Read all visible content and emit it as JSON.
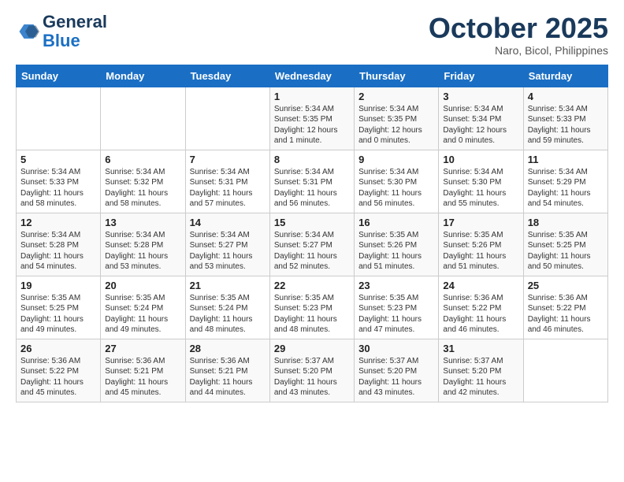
{
  "header": {
    "logo_line1": "General",
    "logo_line2": "Blue",
    "month": "October 2025",
    "location": "Naro, Bicol, Philippines"
  },
  "days_of_week": [
    "Sunday",
    "Monday",
    "Tuesday",
    "Wednesday",
    "Thursday",
    "Friday",
    "Saturday"
  ],
  "weeks": [
    [
      {
        "day": "",
        "info": ""
      },
      {
        "day": "",
        "info": ""
      },
      {
        "day": "",
        "info": ""
      },
      {
        "day": "1",
        "info": "Sunrise: 5:34 AM\nSunset: 5:35 PM\nDaylight: 12 hours\nand 1 minute."
      },
      {
        "day": "2",
        "info": "Sunrise: 5:34 AM\nSunset: 5:35 PM\nDaylight: 12 hours\nand 0 minutes."
      },
      {
        "day": "3",
        "info": "Sunrise: 5:34 AM\nSunset: 5:34 PM\nDaylight: 12 hours\nand 0 minutes."
      },
      {
        "day": "4",
        "info": "Sunrise: 5:34 AM\nSunset: 5:33 PM\nDaylight: 11 hours\nand 59 minutes."
      }
    ],
    [
      {
        "day": "5",
        "info": "Sunrise: 5:34 AM\nSunset: 5:33 PM\nDaylight: 11 hours\nand 58 minutes."
      },
      {
        "day": "6",
        "info": "Sunrise: 5:34 AM\nSunset: 5:32 PM\nDaylight: 11 hours\nand 58 minutes."
      },
      {
        "day": "7",
        "info": "Sunrise: 5:34 AM\nSunset: 5:31 PM\nDaylight: 11 hours\nand 57 minutes."
      },
      {
        "day": "8",
        "info": "Sunrise: 5:34 AM\nSunset: 5:31 PM\nDaylight: 11 hours\nand 56 minutes."
      },
      {
        "day": "9",
        "info": "Sunrise: 5:34 AM\nSunset: 5:30 PM\nDaylight: 11 hours\nand 56 minutes."
      },
      {
        "day": "10",
        "info": "Sunrise: 5:34 AM\nSunset: 5:30 PM\nDaylight: 11 hours\nand 55 minutes."
      },
      {
        "day": "11",
        "info": "Sunrise: 5:34 AM\nSunset: 5:29 PM\nDaylight: 11 hours\nand 54 minutes."
      }
    ],
    [
      {
        "day": "12",
        "info": "Sunrise: 5:34 AM\nSunset: 5:28 PM\nDaylight: 11 hours\nand 54 minutes."
      },
      {
        "day": "13",
        "info": "Sunrise: 5:34 AM\nSunset: 5:28 PM\nDaylight: 11 hours\nand 53 minutes."
      },
      {
        "day": "14",
        "info": "Sunrise: 5:34 AM\nSunset: 5:27 PM\nDaylight: 11 hours\nand 53 minutes."
      },
      {
        "day": "15",
        "info": "Sunrise: 5:34 AM\nSunset: 5:27 PM\nDaylight: 11 hours\nand 52 minutes."
      },
      {
        "day": "16",
        "info": "Sunrise: 5:35 AM\nSunset: 5:26 PM\nDaylight: 11 hours\nand 51 minutes."
      },
      {
        "day": "17",
        "info": "Sunrise: 5:35 AM\nSunset: 5:26 PM\nDaylight: 11 hours\nand 51 minutes."
      },
      {
        "day": "18",
        "info": "Sunrise: 5:35 AM\nSunset: 5:25 PM\nDaylight: 11 hours\nand 50 minutes."
      }
    ],
    [
      {
        "day": "19",
        "info": "Sunrise: 5:35 AM\nSunset: 5:25 PM\nDaylight: 11 hours\nand 49 minutes."
      },
      {
        "day": "20",
        "info": "Sunrise: 5:35 AM\nSunset: 5:24 PM\nDaylight: 11 hours\nand 49 minutes."
      },
      {
        "day": "21",
        "info": "Sunrise: 5:35 AM\nSunset: 5:24 PM\nDaylight: 11 hours\nand 48 minutes."
      },
      {
        "day": "22",
        "info": "Sunrise: 5:35 AM\nSunset: 5:23 PM\nDaylight: 11 hours\nand 48 minutes."
      },
      {
        "day": "23",
        "info": "Sunrise: 5:35 AM\nSunset: 5:23 PM\nDaylight: 11 hours\nand 47 minutes."
      },
      {
        "day": "24",
        "info": "Sunrise: 5:36 AM\nSunset: 5:22 PM\nDaylight: 11 hours\nand 46 minutes."
      },
      {
        "day": "25",
        "info": "Sunrise: 5:36 AM\nSunset: 5:22 PM\nDaylight: 11 hours\nand 46 minutes."
      }
    ],
    [
      {
        "day": "26",
        "info": "Sunrise: 5:36 AM\nSunset: 5:22 PM\nDaylight: 11 hours\nand 45 minutes."
      },
      {
        "day": "27",
        "info": "Sunrise: 5:36 AM\nSunset: 5:21 PM\nDaylight: 11 hours\nand 45 minutes."
      },
      {
        "day": "28",
        "info": "Sunrise: 5:36 AM\nSunset: 5:21 PM\nDaylight: 11 hours\nand 44 minutes."
      },
      {
        "day": "29",
        "info": "Sunrise: 5:37 AM\nSunset: 5:20 PM\nDaylight: 11 hours\nand 43 minutes."
      },
      {
        "day": "30",
        "info": "Sunrise: 5:37 AM\nSunset: 5:20 PM\nDaylight: 11 hours\nand 43 minutes."
      },
      {
        "day": "31",
        "info": "Sunrise: 5:37 AM\nSunset: 5:20 PM\nDaylight: 11 hours\nand 42 minutes."
      },
      {
        "day": "",
        "info": ""
      }
    ]
  ]
}
